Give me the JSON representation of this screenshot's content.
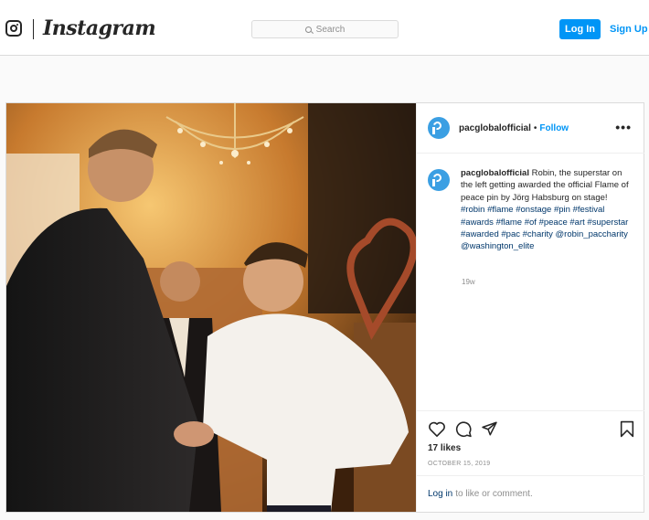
{
  "header": {
    "brand": "Instagram",
    "search_placeholder": "Search",
    "login_label": "Log In",
    "signup_label": "Sign Up"
  },
  "post": {
    "username": "pacglobalofficial",
    "follow_label": "Follow",
    "separator": "•",
    "more_label": "•••",
    "caption_user": "pacglobalofficial",
    "caption_text": "Robin, the superstar on the left getting awarded the official Flame of peace pin by Jörg Habsburg on stage!",
    "hashtags": [
      "#robin",
      "#flame",
      "#onstage",
      "#pin",
      "#festival",
      "#awards",
      "#flame",
      "#of",
      "#peace",
      "#art",
      "#superstar",
      "#awarded",
      "#pac",
      "#charity",
      "@robin_paccharity",
      "@washington_elite"
    ],
    "time_ago": "19w",
    "likes": "17 likes",
    "date": "OCTOBER 15, 2019",
    "comment_login_link": "Log in",
    "comment_prompt": "to like or comment."
  },
  "icons": {
    "like": "heart-icon",
    "comment": "comment-icon",
    "share": "share-icon",
    "save": "bookmark-icon",
    "logo": "instagram-logo-icon",
    "search": "search-icon",
    "avatar": "pac-avatar-icon"
  },
  "colors": {
    "accent": "#0095f6",
    "link": "#00376b",
    "text": "#262626",
    "muted": "#8e8e8e",
    "border": "#dbdbdb",
    "avatar": "#3b9fe3"
  }
}
